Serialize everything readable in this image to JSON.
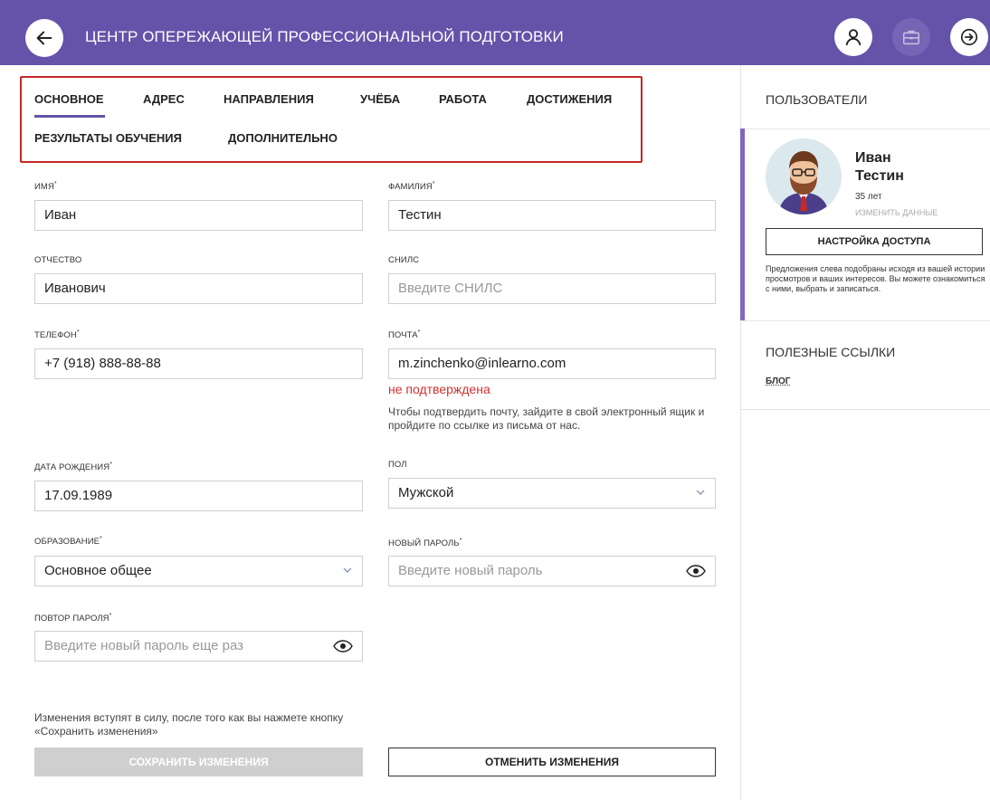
{
  "header": {
    "title": "ЦЕНТР ОПЕРЕЖАЮЩЕЙ ПРОФЕССИОНАЛЬНОЙ ПОДГОТОВКИ",
    "accent": "#6553a9"
  },
  "tabs": [
    {
      "label": "ОСНОВНОЕ",
      "active": true
    },
    {
      "label": "АДРЕС"
    },
    {
      "label": "НАПРАВЛЕНИЯ"
    },
    {
      "label": "УЧЁБА"
    },
    {
      "label": "РАБОТА"
    },
    {
      "label": "ДОСТИЖЕНИЯ"
    },
    {
      "label": "РЕЗУЛЬТАТЫ ОБУЧЕНИЯ"
    },
    {
      "label": "ДОПОЛНИТЕЛЬНО"
    }
  ],
  "form": {
    "first_name": {
      "label": "ИМЯ",
      "value": "Иван"
    },
    "last_name": {
      "label": "ФАМИЛИЯ",
      "value": "Тестин"
    },
    "patronymic": {
      "label": "ОТЧЕСТВО",
      "value": "Иванович"
    },
    "snils": {
      "label": "СНИЛС",
      "placeholder": "Введите СНИЛС"
    },
    "phone": {
      "label": "ТЕЛЕФОН",
      "value": "+7 (918) 888-88-88"
    },
    "email": {
      "label": "ПОЧТА",
      "value": "m.zinchenko@inlearno.com",
      "status": "не подтверждена",
      "hint": "Чтобы подтвердить почту, зайдите в свой электронный ящик и пройдите по ссылке из письма от нас."
    },
    "birth_date": {
      "label": "ДАТА РОЖДЕНИЯ",
      "value": "17.09.1989"
    },
    "gender": {
      "label": "ПОЛ",
      "value": "Мужской"
    },
    "education": {
      "label": "ОБРАЗОВАНИЕ",
      "value": "Основное общее"
    },
    "new_password": {
      "label": "НОВЫЙ ПАРОЛЬ",
      "placeholder": "Введите новый пароль"
    },
    "repeat_password": {
      "label": "ПОВТОР ПАРОЛЯ",
      "placeholder": "Введите новый пароль еще раз"
    },
    "required_mark": "*",
    "note": "Изменения вступят в силу, после того как вы нажмете кнопку «Сохранить изменения»",
    "save_label": "СОХРАНИТЬ ИЗМЕНЕНИЯ",
    "cancel_label": "ОТМЕНИТЬ ИЗМЕНЕНИЯ"
  },
  "sidebar": {
    "users_title": "ПОЛЬЗОВАТЕЛИ",
    "user": {
      "first": "Иван",
      "last": "Тестин",
      "age": "35 лет",
      "edit": "ИЗМЕНИТЬ ДАННЫЕ"
    },
    "access_label": "НАСТРОЙКА ДОСТУПА",
    "description": "Предложения слева подобраны исходя из вашей истории просмотров и ваших интересов. Вы можете ознакомиться с ними, выбрать и записаться.",
    "links_title": "ПОЛЕЗНЫЕ ССЫЛКИ",
    "links": [
      {
        "label": "БЛОГ"
      }
    ]
  },
  "icons": [
    "back-arrow-icon",
    "user-icon",
    "briefcase-icon",
    "logout-icon",
    "chevron-down-icon",
    "eye-icon"
  ]
}
